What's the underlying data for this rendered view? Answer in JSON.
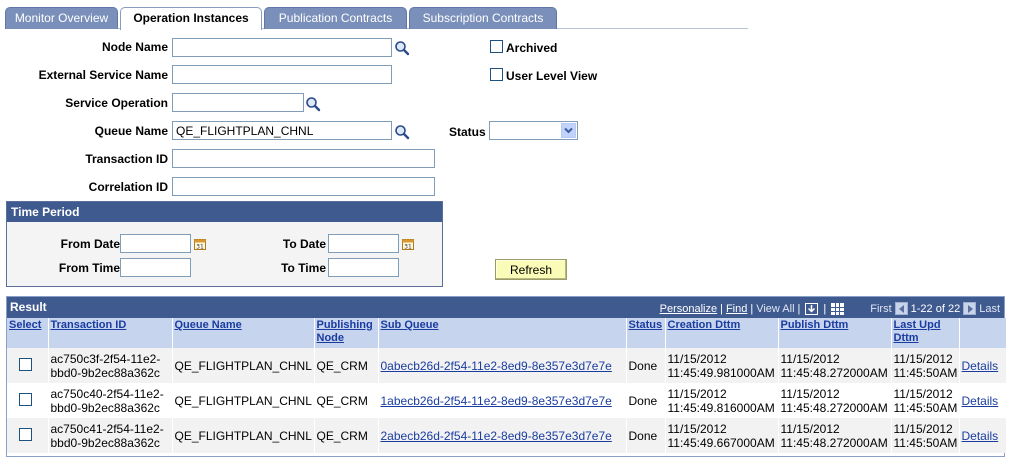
{
  "tabs": [
    {
      "label": "Monitor Overview",
      "active": false
    },
    {
      "label": "Operation Instances",
      "active": true
    },
    {
      "label": "Publication Contracts",
      "active": false
    },
    {
      "label": "Subscription Contracts",
      "active": false
    }
  ],
  "form": {
    "node_name_label": "Node Name",
    "node_name_value": "",
    "external_service_label": "External Service Name",
    "external_service_value": "",
    "service_operation_label": "Service Operation",
    "service_operation_value": "",
    "queue_name_label": "Queue Name",
    "queue_name_value": "QE_FLIGHTPLAN_CHNL",
    "status_label": "Status",
    "status_value": "",
    "transaction_id_label": "Transaction ID",
    "transaction_id_value": "",
    "correlation_id_label": "Correlation ID",
    "correlation_id_value": "",
    "archived_label": "Archived",
    "user_level_view_label": "User Level View"
  },
  "time_period": {
    "title": "Time Period",
    "from_date_label": "From Date",
    "to_date_label": "To Date",
    "from_time_label": "From Time",
    "to_time_label": "To Time",
    "from_date": "",
    "to_date": "",
    "from_time": "",
    "to_time": ""
  },
  "refresh_label": "Refresh",
  "grid": {
    "title": "Result",
    "personalize": "Personalize",
    "find": "Find",
    "view_all": "View All",
    "first": "First",
    "range": "1-22 of 22",
    "last": "Last",
    "columns": [
      "Select",
      "Transaction ID",
      "Queue Name",
      "Publishing Node",
      "Sub Queue",
      "Status",
      "Creation Dttm",
      "Publish Dttm",
      "Last Upd Dttm",
      ""
    ],
    "rows": [
      {
        "txn_line1": "ac750c3f-2f54-11e2-",
        "txn_line2": "bbd0-9b2ec88a362c",
        "queue": "QE_FLIGHTPLAN_CHNL",
        "node": "QE_CRM",
        "sub_queue": "0abecb26d-2f54-11e2-8ed9-8e357e3d7e7e",
        "status": "Done",
        "created_date": "11/15/2012",
        "created_time": "11:45:49.981000AM",
        "published_date": "11/15/2012",
        "published_time": "11:45:48.272000AM",
        "updated_date": "11/15/2012",
        "updated_time": "11:45:50AM",
        "details": "Details"
      },
      {
        "txn_line1": "ac750c40-2f54-11e2-",
        "txn_line2": "bbd0-9b2ec88a362c",
        "queue": "QE_FLIGHTPLAN_CHNL",
        "node": "QE_CRM",
        "sub_queue": "1abecb26d-2f54-11e2-8ed9-8e357e3d7e7e",
        "status": "Done",
        "created_date": "11/15/2012",
        "created_time": "11:45:49.816000AM",
        "published_date": "11/15/2012",
        "published_time": "11:45:48.272000AM",
        "updated_date": "11/15/2012",
        "updated_time": "11:45:50AM",
        "details": "Details"
      },
      {
        "txn_line1": "ac750c41-2f54-11e2-",
        "txn_line2": "bbd0-9b2ec88a362c",
        "queue": "QE_FLIGHTPLAN_CHNL",
        "node": "QE_CRM",
        "sub_queue": "2abecb26d-2f54-11e2-8ed9-8e357e3d7e7e",
        "status": "Done",
        "created_date": "11/15/2012",
        "created_time": "11:45:49.667000AM",
        "published_date": "11/15/2012",
        "published_time": "11:45:48.272000AM",
        "updated_date": "11/15/2012",
        "updated_time": "11:45:50AM",
        "details": "Details"
      }
    ]
  },
  "colors": {
    "tab_inactive": "#7a90ba",
    "header_blue": "#3f5a8f",
    "column_header": "#c6d4ee",
    "link": "#1a3ca0",
    "refresh_button": "#fbfbb8"
  },
  "icons": {
    "lookup": "magnifier-icon",
    "calendar": "calendar-icon"
  }
}
